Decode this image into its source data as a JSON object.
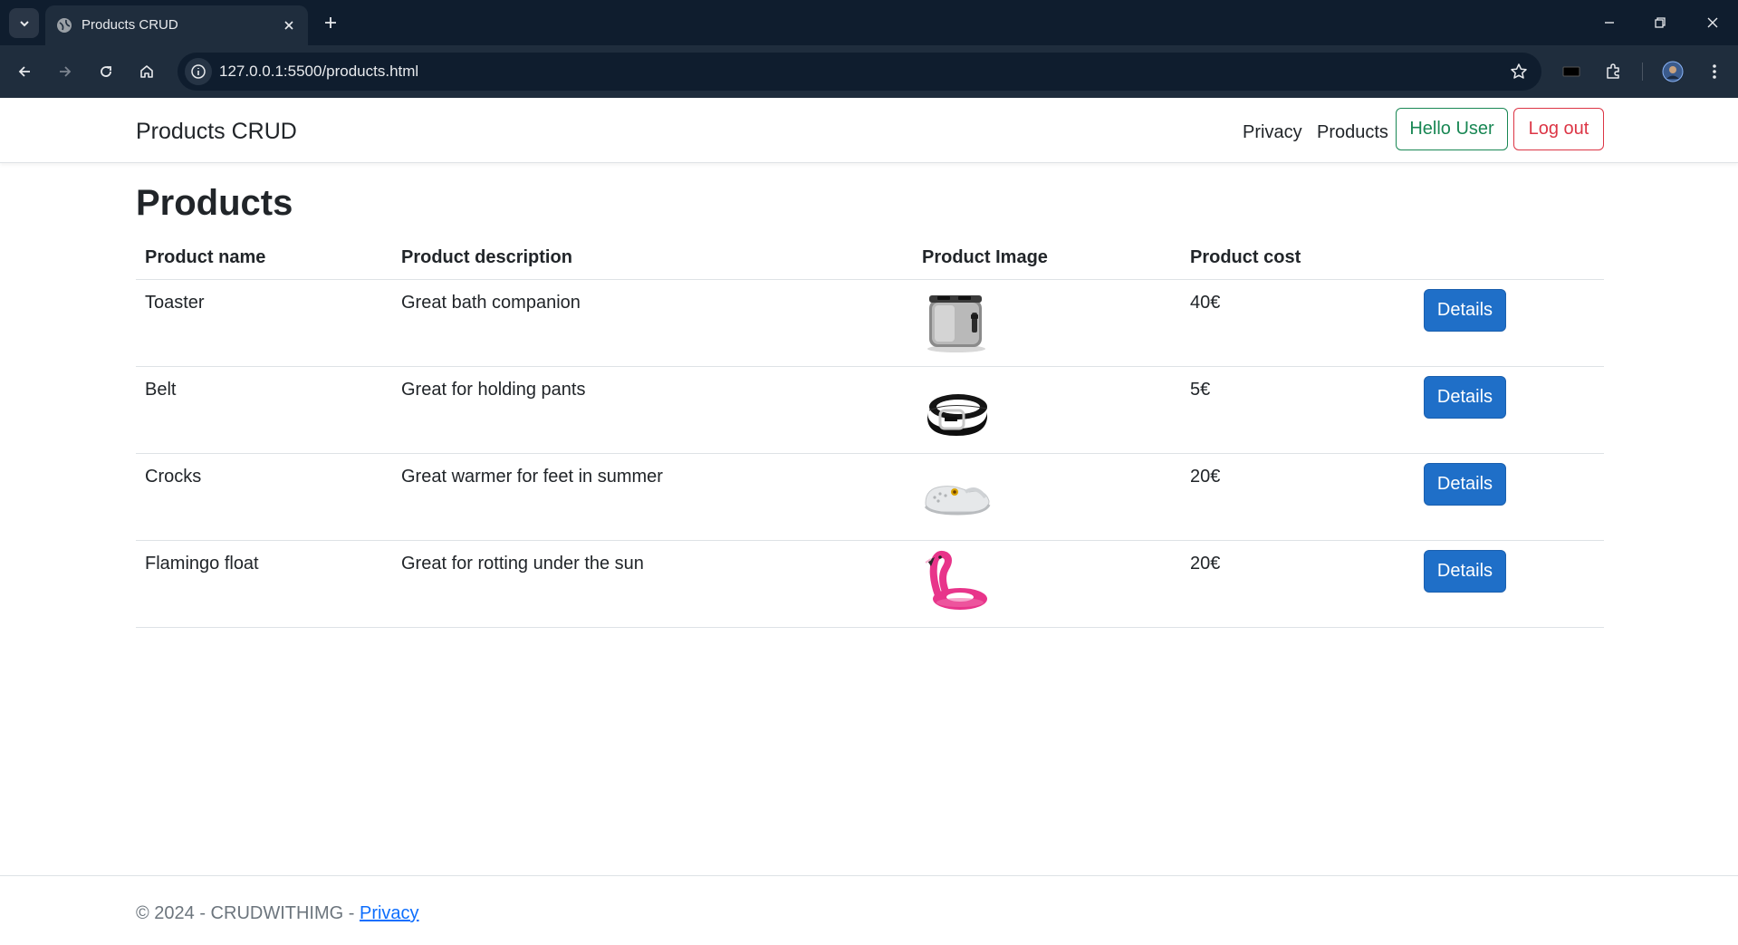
{
  "browser": {
    "tab_title": "Products CRUD",
    "url": "127.0.0.1:5500/products.html"
  },
  "navbar": {
    "brand": "Products CRUD",
    "links": [
      "Privacy",
      "Products"
    ],
    "hello_button": "Hello User",
    "logout_button": "Log out"
  },
  "page": {
    "title": "Products"
  },
  "table": {
    "headers": [
      "Product name",
      "Product description",
      "Product Image",
      "Product cost"
    ],
    "rows": [
      {
        "name": "Toaster",
        "description": "Great bath companion",
        "image": "toaster-image",
        "cost": "40€",
        "action": "Details"
      },
      {
        "name": "Belt",
        "description": "Great for holding pants",
        "image": "belt-image",
        "cost": "5€",
        "action": "Details"
      },
      {
        "name": "Crocks",
        "description": "Great warmer for feet in summer",
        "image": "crocs-image",
        "cost": "20€",
        "action": "Details"
      },
      {
        "name": "Flamingo float",
        "description": "Great for rotting under the sun",
        "image": "flamingo-float-image",
        "cost": "20€",
        "action": "Details"
      }
    ]
  },
  "footer": {
    "text": "© 2024 - CRUDWITHIMG - ",
    "link": "Privacy"
  },
  "colors": {
    "chrome_dark": "#0f1d2e",
    "chrome_toolbar": "#1f2d3d",
    "success": "#198754",
    "danger": "#dc3545",
    "primary": "#1f6fc8"
  }
}
